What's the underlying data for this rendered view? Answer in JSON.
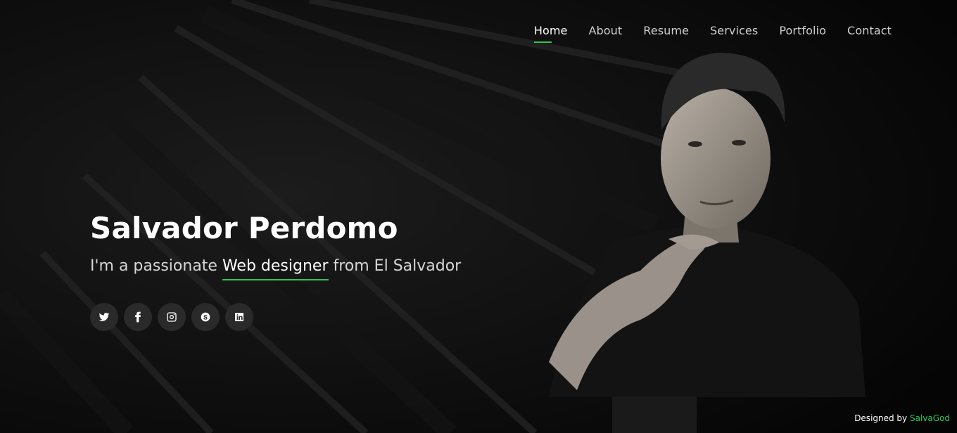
{
  "nav": {
    "items": [
      {
        "label": "Home",
        "active": true
      },
      {
        "label": "About",
        "active": false
      },
      {
        "label": "Resume",
        "active": false
      },
      {
        "label": "Services",
        "active": false
      },
      {
        "label": "Portfolio",
        "active": false
      },
      {
        "label": "Contact",
        "active": false
      }
    ]
  },
  "hero": {
    "name": "Salvador Perdomo",
    "tagline_prefix": "I'm a passionate ",
    "tagline_typed": "Web designer",
    "tagline_suffix": " from El Salvador"
  },
  "socials": [
    {
      "icon": "twitter-icon"
    },
    {
      "icon": "facebook-icon"
    },
    {
      "icon": "instagram-icon"
    },
    {
      "icon": "skype-icon"
    },
    {
      "icon": "linkedin-icon"
    }
  ],
  "credits": {
    "prefix": "Designed by ",
    "author": "SalvaGod"
  },
  "colors": {
    "accent": "#2ec75a",
    "background": "#0a0a0a",
    "social_bg": "#2a2a2a"
  }
}
